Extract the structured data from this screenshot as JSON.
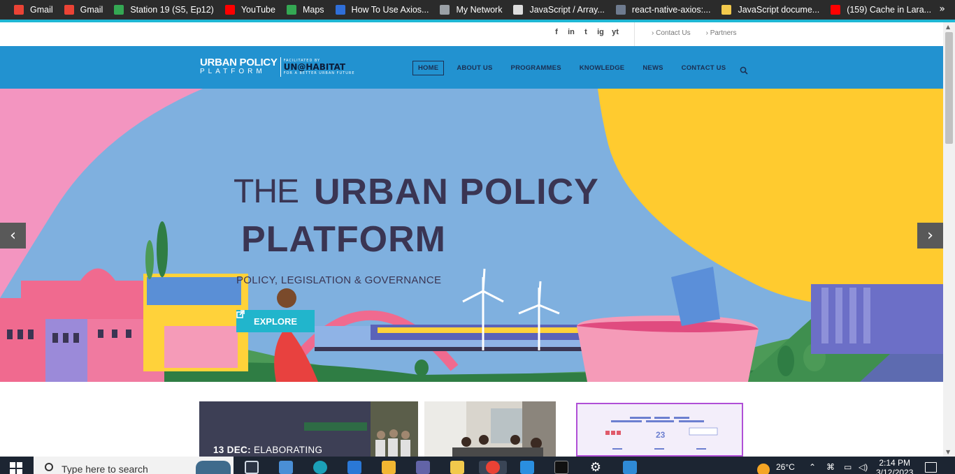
{
  "bookmarks": [
    {
      "label": "Gmail",
      "icon": "gmail-icon",
      "color": "#ea4335"
    },
    {
      "label": "Gmail",
      "icon": "gmail-icon",
      "color": "#ea4335"
    },
    {
      "label": "Station 19 (S5, Ep12)",
      "icon": "play-icon",
      "color": "#34a853"
    },
    {
      "label": "YouTube",
      "icon": "youtube-icon",
      "color": "#ff0000"
    },
    {
      "label": "Maps",
      "icon": "maps-icon",
      "color": "#34a853"
    },
    {
      "label": "How To Use Axios...",
      "icon": "axios-icon",
      "color": "#2f6fd9"
    },
    {
      "label": "My Network",
      "icon": "globe-icon",
      "color": "#9aa0a6"
    },
    {
      "label": "JavaScript / Array...",
      "icon": "search-page-icon",
      "color": "#dddddd"
    },
    {
      "label": "react-native-axios:...",
      "icon": "shield-icon",
      "color": "#6e7b8f"
    },
    {
      "label": "JavaScript docume...",
      "icon": "js-doc-icon",
      "color": "#f2c94c"
    },
    {
      "label": "(159) Cache in Lara...",
      "icon": "youtube-icon",
      "color": "#ff0000"
    }
  ],
  "bookmarks_more": "»",
  "topbar": {
    "social": [
      "f",
      "in",
      "t",
      "ig",
      "yt"
    ],
    "links": [
      "Contact Us",
      "Partners"
    ]
  },
  "logo": {
    "line1": "URBAN POLICY",
    "line2": "PLATFORM",
    "facilitated": "FACILITATED BY",
    "org": "UN@HABITAT",
    "tagline": "FOR A BETTER URBAN FUTURE"
  },
  "menu": [
    "HOME",
    "ABOUT US",
    "PROGRAMMES",
    "KNOWLEDGE",
    "NEWS",
    "CONTACT US"
  ],
  "hero": {
    "title_prefix": "THE",
    "title_line1": "URBAN POLICY",
    "title_line2": "PLATFORM",
    "subtitle": "POLICY, LEGISLATION & GOVERNANCE",
    "button": "EXPLORE",
    "prev": "‹",
    "next": "›"
  },
  "cards": {
    "card1_date": "13 DEC:",
    "card1_title": "ELABORATING"
  },
  "taskbar": {
    "search_placeholder": "Type here to search",
    "temperature": "26°C",
    "time": "2:14 PM",
    "date": "3/12/2023"
  },
  "colors": {
    "nav": "#2292d0",
    "accent": "#1fb7d4",
    "hero_sky": "#7fb0df",
    "hero_pink": "#f395c0",
    "hero_yellow": "#ffcb2f",
    "title": "#3a3553"
  }
}
